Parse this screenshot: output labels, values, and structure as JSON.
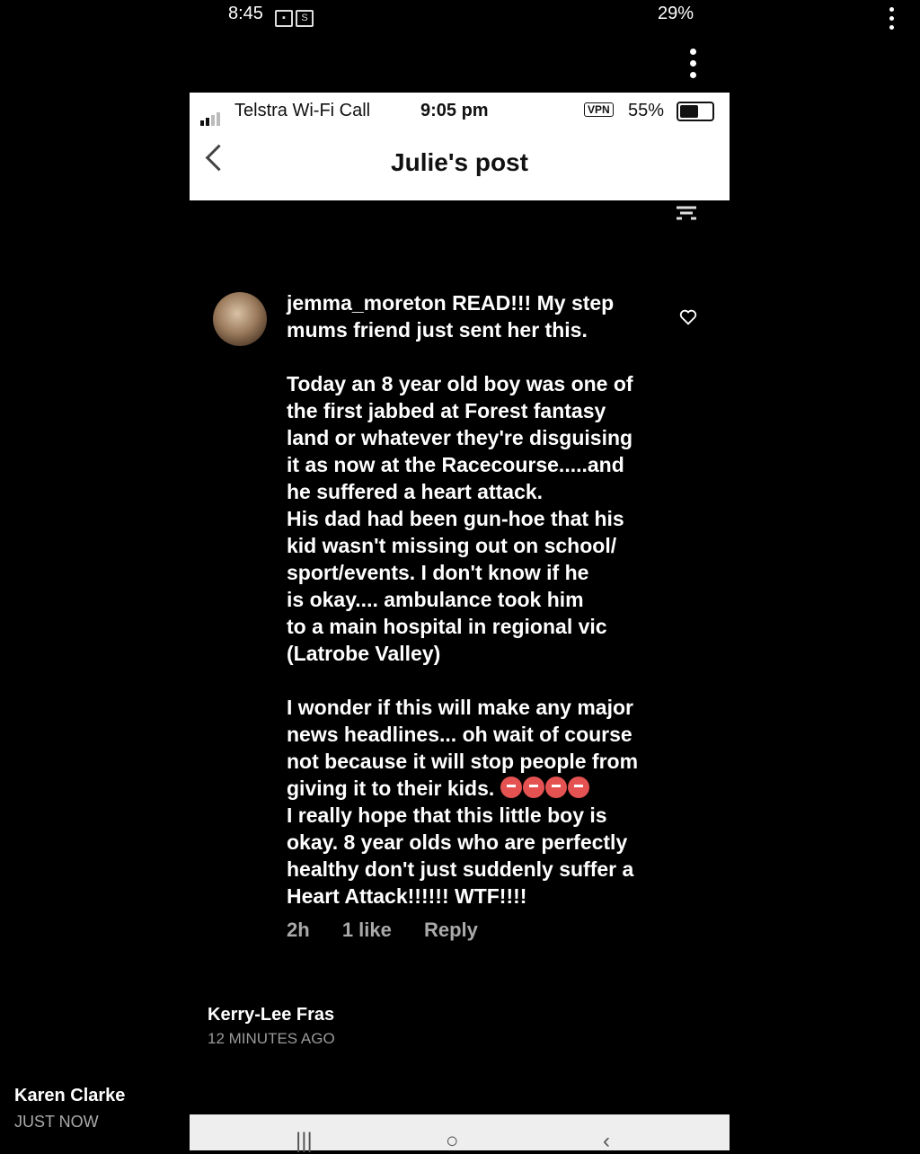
{
  "outer": {
    "menu_icon": "kebab-icon",
    "author": "Karen Clarke",
    "time": "JUST NOW"
  },
  "android_status": {
    "time": "8:45",
    "right": "29%"
  },
  "ios_status": {
    "carrier": "Telstra Wi-Fi Call",
    "time": "9:05 pm",
    "vpn": "VPN",
    "battery": "55%"
  },
  "screen": {
    "title": "Julie's post"
  },
  "comment": {
    "username": "jemma_moreton",
    "text_lines": "READ!!! My step\nmums friend just sent her this.\n\nToday an 8 year old boy was one of\nthe first jabbed at Forest fantasy\nland or whatever they're disguising\nit as now at the Racecourse.....and\nhe suffered a heart attack.\nHis dad had been gun-hoe that his\nkid wasn't missing out on school/\nsport/events. I don't know if he\nis okay.... ambulance took him\nto a main hospital in regional vic\n(Latrobe Valley)\n\nI wonder if this will make any major\nnews headlines... oh wait of course\nnot because it will stop people from\ngiving it to their kids. ",
    "text_end": "I really hope that this little boy is\nokay. 8 year olds who are perfectly\nhealthy don't just suddenly suffer a\nHeart Attack!!!!!! WTF!!!!",
    "age": "2h",
    "likes": "1 like",
    "reply": "Reply"
  },
  "reply": {
    "author": "Kerry-Lee Fras",
    "time": "12 MINUTES AGO"
  }
}
